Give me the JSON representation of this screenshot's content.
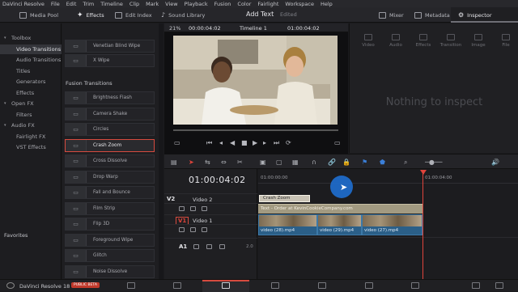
{
  "menu": [
    "DaVinci Resolve",
    "File",
    "Edit",
    "Trim",
    "Timeline",
    "Clip",
    "Mark",
    "View",
    "Playback",
    "Fusion",
    "Color",
    "Fairlight",
    "Workspace",
    "Help"
  ],
  "toolbar": {
    "media_pool": "Media Pool",
    "effects": "Effects",
    "edit_index": "Edit Index",
    "sound_library": "Sound Library",
    "title": "Add Text",
    "status": "Edited",
    "mixer": "Mixer",
    "metadata": "Metadata",
    "inspector": "Inspector"
  },
  "tree": {
    "items": [
      {
        "label": "Toolbox",
        "level": 0,
        "selected": false
      },
      {
        "label": "Video Transitions",
        "level": 1,
        "selected": true
      },
      {
        "label": "Audio Transitions",
        "level": 1,
        "selected": false
      },
      {
        "label": "Titles",
        "level": 1,
        "selected": false
      },
      {
        "label": "Generators",
        "level": 1,
        "selected": false
      },
      {
        "label": "Effects",
        "level": 1,
        "selected": false
      },
      {
        "label": "Open FX",
        "level": 0,
        "selected": false
      },
      {
        "label": "Filters",
        "level": 1,
        "selected": false
      },
      {
        "label": "Audio FX",
        "level": 0,
        "selected": false
      },
      {
        "label": "Fairlight FX",
        "level": 1,
        "selected": false
      },
      {
        "label": "VST Effects",
        "level": 1,
        "selected": false
      }
    ],
    "favorites": "Favorites"
  },
  "effects_list": {
    "top_items": [
      "Venetian Blind Wipe",
      "X Wipe"
    ],
    "section": "Fusion Transitions",
    "items": [
      "Brightness Flash",
      "Camera Shake",
      "Circles",
      "Crash Zoom",
      "Cross Dissolve",
      "Drop Warp",
      "Fall and Bounce",
      "Film Strip",
      "Flip 3D",
      "Foreground Wipe",
      "Glitch",
      "Noise Dissolve"
    ],
    "selected": "Crash Zoom"
  },
  "viewer": {
    "zoom": "21%",
    "tc_left": "00:00:04:02",
    "timeline": "Timeline 1",
    "tc_right": "01:00:04:02"
  },
  "inspector": {
    "tabs": [
      "Video",
      "Audio",
      "Effects",
      "Transition",
      "Image",
      "File"
    ],
    "empty": "Nothing to inspect"
  },
  "timeline": {
    "timecode": "01:00:04:02",
    "ruler": [
      "01:00:00:00",
      "01:00:04:00"
    ],
    "tracks": [
      {
        "id": "V2",
        "name": "Video 2"
      },
      {
        "id": "V1",
        "name": "Video 1"
      },
      {
        "id": "A1",
        "name": "",
        "level": "2.0"
      }
    ],
    "fx_clip": "Crash Zoom",
    "text_clip": "Text - Order at KevinCookieCompany.com",
    "video_clips": [
      "video (28).mp4",
      "video (29).mp4",
      "video (27).mp4"
    ]
  },
  "bottom": {
    "app": "DaVinci Resolve 18",
    "badge": "PUBLIC BETA"
  },
  "colors": {
    "accent_red": "#e0443b",
    "clip_blue": "#2b5f88",
    "text_clip": "#a29a81"
  }
}
